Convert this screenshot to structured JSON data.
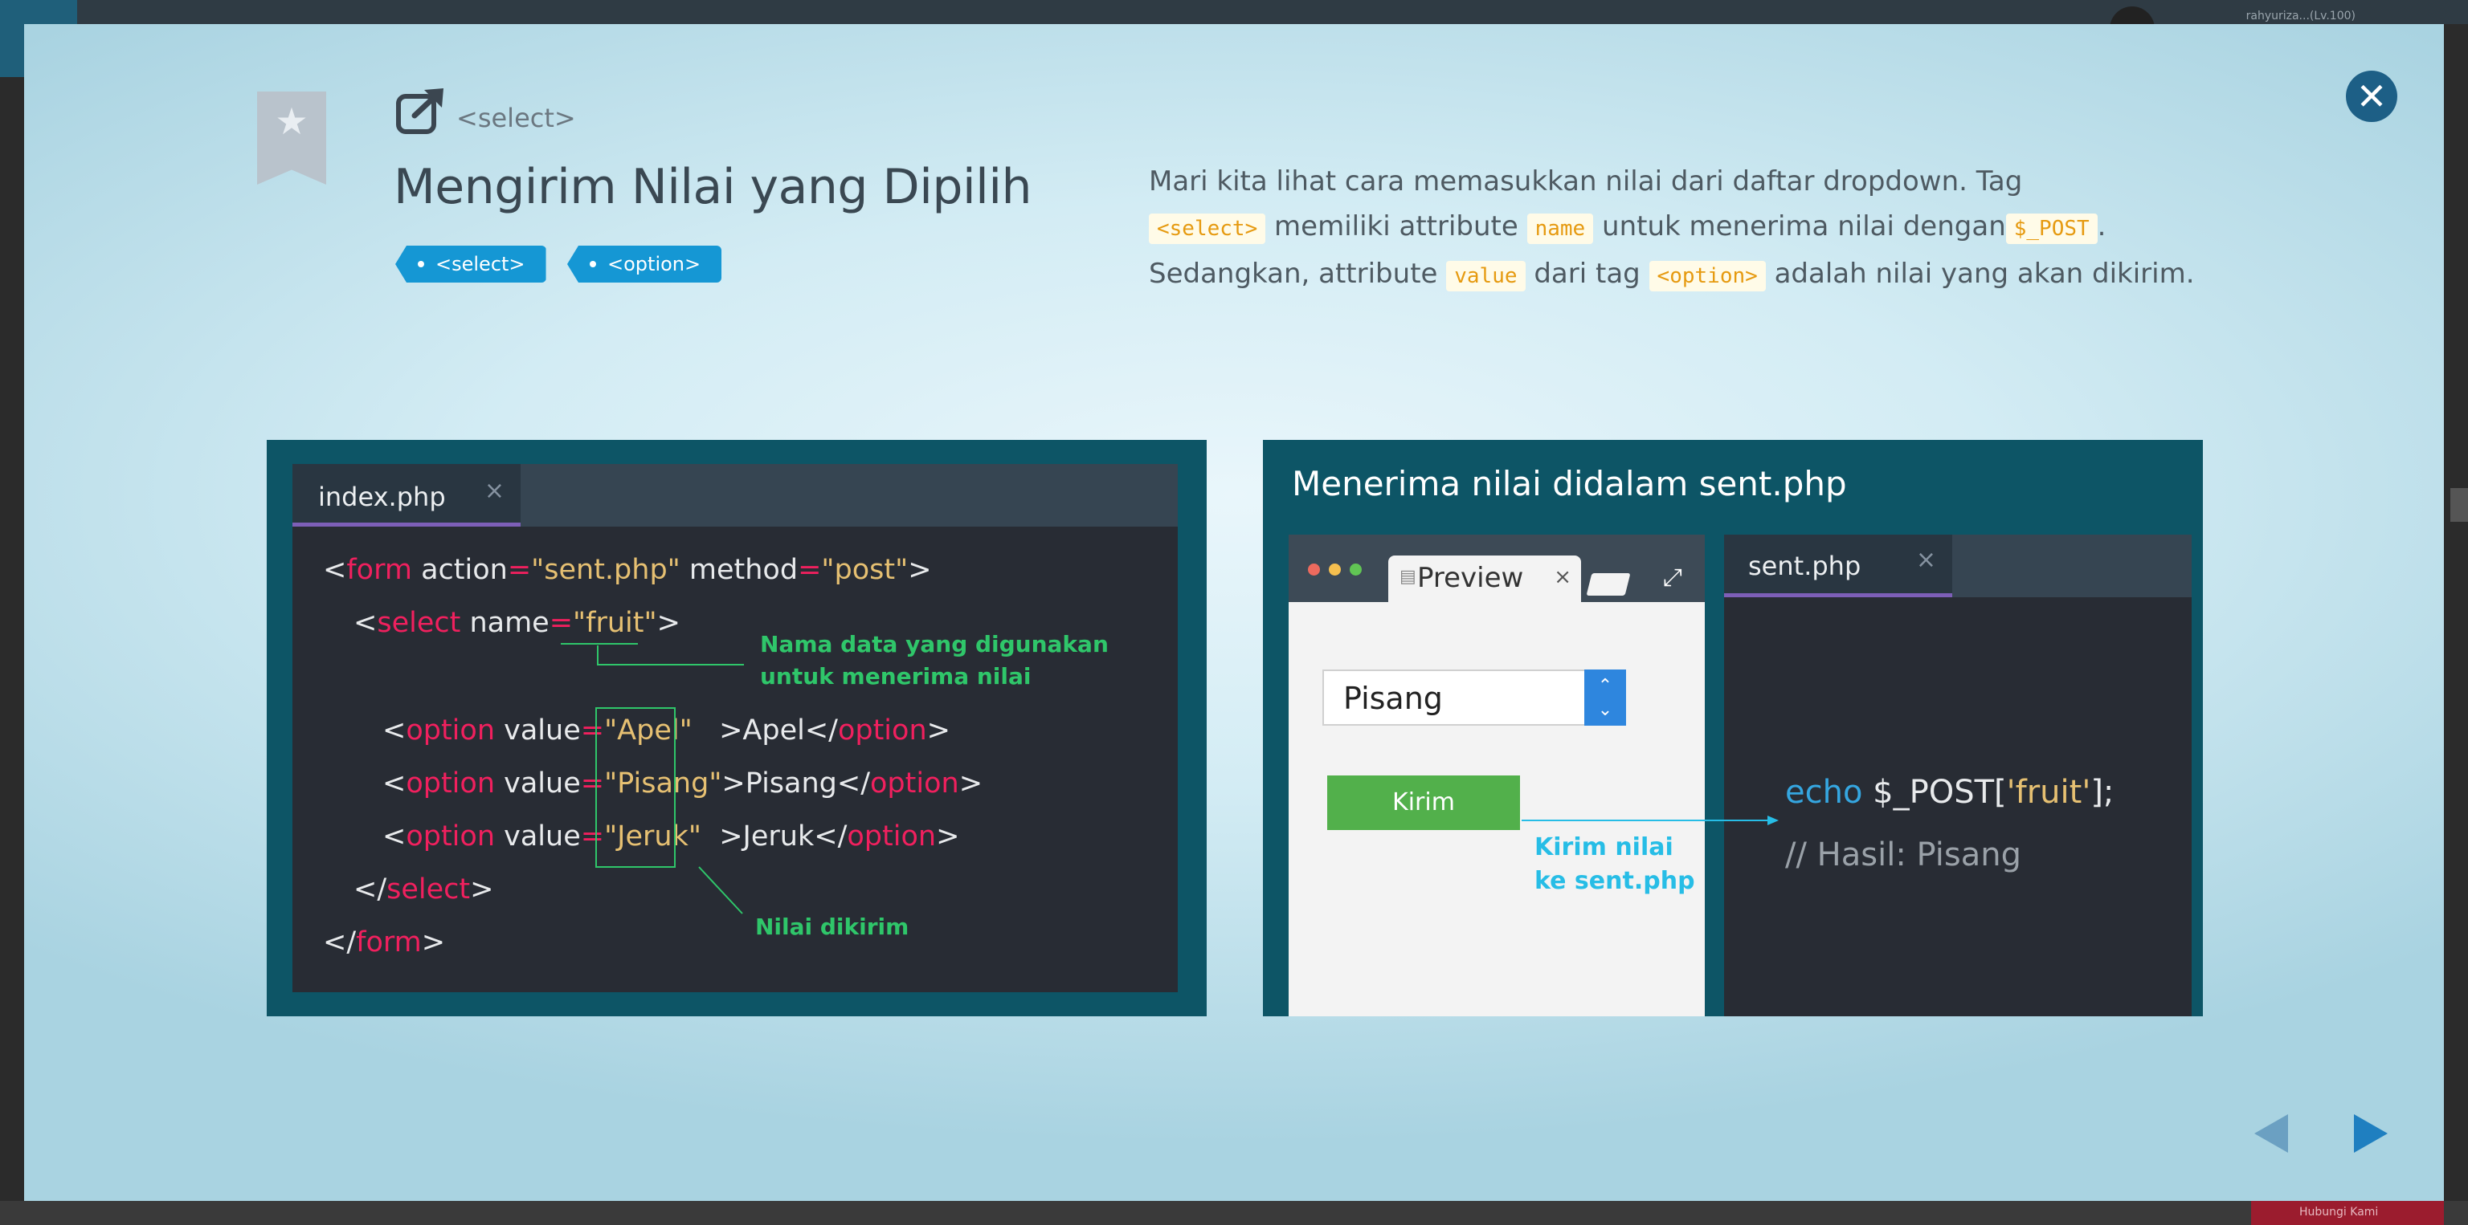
{
  "background": {
    "username": "rahyuriza...(Lv.100)",
    "bottom_button": "Hubungi Kami"
  },
  "modal": {
    "header_label": "<select>",
    "title": "Mengirim Nilai yang Dipilih",
    "tags": [
      "<select>",
      "<option>"
    ],
    "description": {
      "p1": "Mari kita lihat cara memasukkan nilai dari daftar dropdown. Tag",
      "c1": "<select>",
      "p2": " memiliki attribute ",
      "c2": "name",
      "p3": " untuk menerima nilai dengan",
      "c3": "$_POST",
      "p4": ". Sedangkan, attribute ",
      "c4": "value",
      "p5": " dari tag ",
      "c5": "<option>",
      "p6": " adalah nilai yang akan dikirim."
    },
    "left_panel": {
      "tab_label": "index.php",
      "tab_close": "×",
      "annotation_name": [
        "Nama data yang digunakan",
        "untuk menerima nilai"
      ],
      "annotation_value": "Nilai dikirim"
    },
    "right_panel": {
      "heading": "Menerima nilai didalam sent.php",
      "browser_tab": "Preview",
      "browser_tab_close": "×",
      "select_value": "Pisang",
      "submit_button": "Kirim",
      "annotation_send": [
        "Kirim nilai",
        "ke sent.php"
      ],
      "editor_tab": "sent.php",
      "editor_tab_close": "×",
      "code_echo_kw": "echo",
      "code_echo_rest": " $_POST[",
      "code_echo_str": "'fruit'",
      "code_echo_end": "];",
      "code_comment": "// Hasil: Pisang"
    },
    "close_icon": "close-icon",
    "nav": {
      "prev_icon": "triangle-left-icon",
      "next_icon": "triangle-right-icon"
    },
    "colors": {
      "accent": "#1597d4",
      "keyword": "#f0205e",
      "string": "#e6c072",
      "annotation": "#2fc66a"
    }
  }
}
